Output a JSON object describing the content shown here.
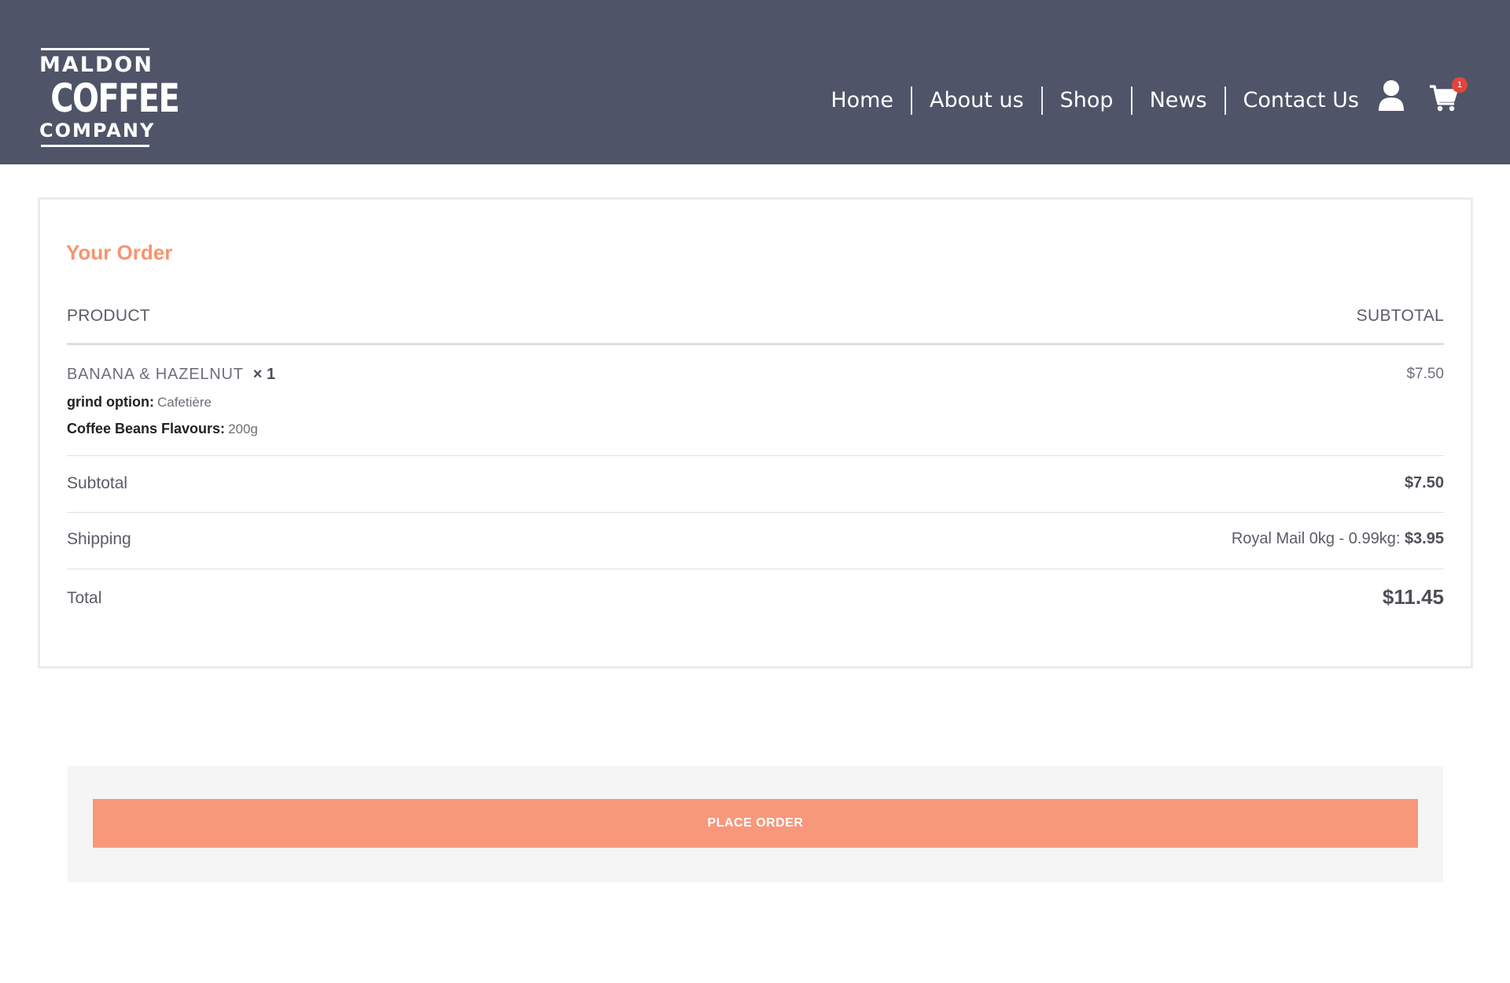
{
  "brand": {
    "logo_line1": "MALDON",
    "logo_line2": "COFFEE",
    "logo_line3": "COMPANY"
  },
  "nav": {
    "items": [
      {
        "label": "Home"
      },
      {
        "label": "About us"
      },
      {
        "label": "Shop"
      },
      {
        "label": "News"
      },
      {
        "label": "Contact Us"
      }
    ],
    "user_icon": "user-icon",
    "cart_icon": "shopping-cart-icon",
    "cart_count": "1"
  },
  "order": {
    "title": "Your Order",
    "columns": {
      "product": "PRODUCT",
      "subtotal": "SUBTOTAL"
    },
    "items": [
      {
        "name": "BANANA & HAZELNUT",
        "qty": "× 1",
        "price": "$7.50",
        "meta": [
          {
            "label": "grind option:",
            "value": "Cafetière"
          },
          {
            "label": "Coffee Beans Flavours:",
            "value": "200g"
          }
        ]
      }
    ],
    "subtotal": {
      "label": "Subtotal",
      "value": "$7.50"
    },
    "shipping": {
      "label": "Shipping",
      "method": "Royal Mail 0kg - 0.99kg:",
      "value": "$3.95"
    },
    "total": {
      "label": "Total",
      "value": "$11.45"
    }
  },
  "payment": {
    "place_order_label": "PLACE ORDER"
  },
  "colors": {
    "header_bg": "#4f5468",
    "accent": "#f8987a",
    "badge": "#e0463c"
  }
}
